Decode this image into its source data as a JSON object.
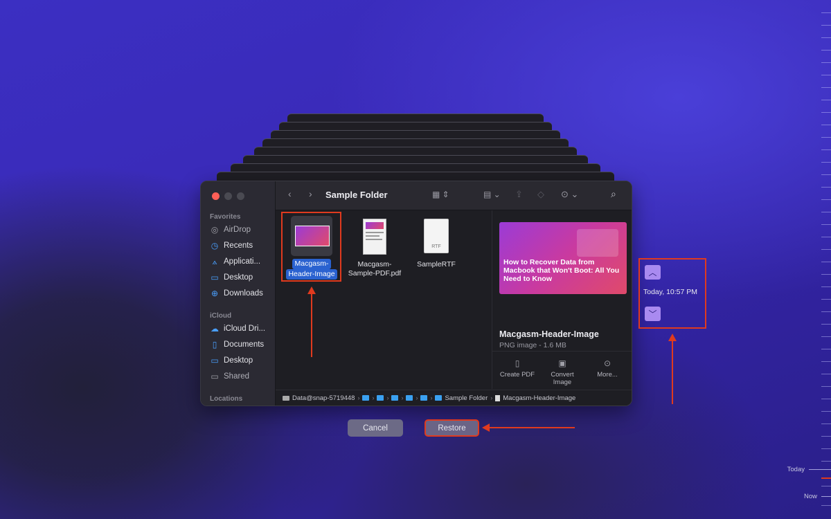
{
  "finder": {
    "title": "Sample Folder",
    "sidebar": {
      "favorites_header": "Favorites",
      "favorites": [
        {
          "label": "AirDrop",
          "icon": "airdrop-icon"
        },
        {
          "label": "Recents",
          "icon": "clock-icon"
        },
        {
          "label": "Applicati...",
          "icon": "applications-icon"
        },
        {
          "label": "Desktop",
          "icon": "desktop-icon"
        },
        {
          "label": "Downloads",
          "icon": "download-icon"
        }
      ],
      "icloud_header": "iCloud",
      "icloud": [
        {
          "label": "iCloud Dri...",
          "icon": "cloud-icon"
        },
        {
          "label": "Documents",
          "icon": "document-icon"
        },
        {
          "label": "Desktop",
          "icon": "desktop-icon"
        },
        {
          "label": "Shared",
          "icon": "shared-folder-icon"
        }
      ],
      "locations_header": "Locations"
    },
    "files": [
      {
        "name_line1": "Macgasm-",
        "name_line2": "Header-Image",
        "selected": true
      },
      {
        "name_line1": "Macgasm-",
        "name_line2": "Sample-PDF.pdf",
        "selected": false
      },
      {
        "name_line1": "SampleRTF",
        "name_line2": "",
        "badge": "RTF",
        "selected": false
      }
    ],
    "preview": {
      "image_headline": "How to Recover Data from Macbook that Won't Boot: All You Need to Know",
      "name": "Macgasm-Header-Image",
      "meta": "PNG image - 1.6 MB",
      "actions": [
        {
          "label_line1": "Create PDF",
          "label_line2": "",
          "icon": "pdf-icon"
        },
        {
          "label_line1": "Convert",
          "label_line2": "Image",
          "icon": "image-icon"
        },
        {
          "label_line1": "More...",
          "label_line2": "",
          "icon": "ellipsis-icon"
        }
      ]
    },
    "pathbar": {
      "root": "Data@snap-5719448",
      "folder": "Sample Folder",
      "file": "Macgasm-Header-Image"
    }
  },
  "buttons": {
    "cancel": "Cancel",
    "restore": "Restore"
  },
  "time_machine": {
    "snapshot_time": "Today, 10:57 PM",
    "timeline_today": "Today",
    "timeline_now": "Now"
  },
  "colors": {
    "annotation_red": "#e03a1e",
    "selection_blue": "#2a62d0",
    "accent_purple": "#a98af0"
  }
}
